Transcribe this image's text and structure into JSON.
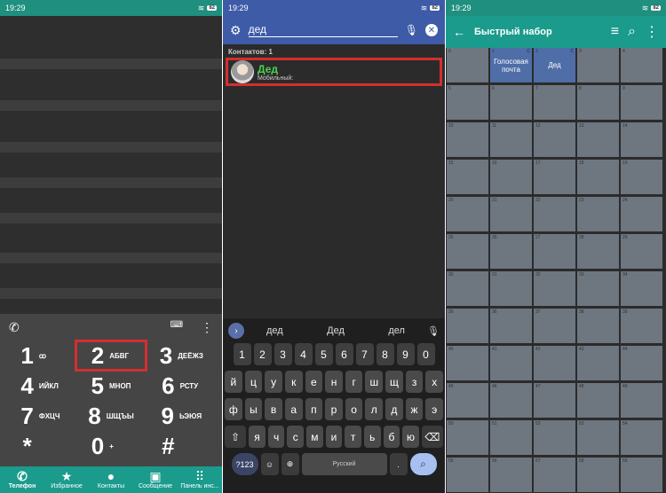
{
  "status": {
    "time": "19:29",
    "battery": "82"
  },
  "dialer": {
    "keys": [
      {
        "digit": "1",
        "letters": "ꝏ"
      },
      {
        "digit": "2",
        "letters": "АБВГ"
      },
      {
        "digit": "3",
        "letters": "ДЕЁЖЗ"
      },
      {
        "digit": "4",
        "letters": "ИЙКЛ"
      },
      {
        "digit": "5",
        "letters": "МНОП"
      },
      {
        "digit": "6",
        "letters": "РСТУ"
      },
      {
        "digit": "7",
        "letters": "ФХЦЧ"
      },
      {
        "digit": "8",
        "letters": "ШЩЪЫ"
      },
      {
        "digit": "9",
        "letters": "ЬЭЮЯ"
      },
      {
        "digit": "*",
        "letters": ""
      },
      {
        "digit": "0",
        "letters": "+"
      },
      {
        "digit": "#",
        "letters": ""
      }
    ],
    "nav": [
      {
        "label": "Телефон",
        "icon": "phone-icon",
        "glyph": "✆"
      },
      {
        "label": "Избранное",
        "icon": "star-icon",
        "glyph": "★"
      },
      {
        "label": "Контакты",
        "icon": "person-icon",
        "glyph": "●"
      },
      {
        "label": "Сообщение",
        "icon": "message-icon",
        "glyph": "▣"
      },
      {
        "label": "Панель инс...",
        "icon": "apps-icon",
        "glyph": "⠿"
      }
    ]
  },
  "search": {
    "query": "дед",
    "count_label": "Контактов: 1",
    "contact": {
      "name": "Дед",
      "type": "Мобильный:"
    },
    "suggestions": [
      "дед",
      "Дед",
      "дел"
    ],
    "rows": [
      [
        "1",
        "2",
        "3",
        "4",
        "5",
        "6",
        "7",
        "8",
        "9",
        "0"
      ],
      [
        "й",
        "ц",
        "у",
        "к",
        "е",
        "н",
        "г",
        "ш",
        "щ",
        "з",
        "х"
      ],
      [
        "ф",
        "ы",
        "в",
        "а",
        "п",
        "р",
        "о",
        "л",
        "д",
        "ж",
        "э"
      ],
      [
        "я",
        "ч",
        "с",
        "м",
        "и",
        "т",
        "ь",
        "б",
        "ю"
      ]
    ],
    "key_symbols": "?123",
    "space_label": "Русский",
    "period": "."
  },
  "speed_dial": {
    "title": "Быстрый набор",
    "cells": [
      {
        "n": "0",
        "label": "",
        "c": ""
      },
      {
        "n": "1",
        "label": "Голосовая почта",
        "c": "С"
      },
      {
        "n": "2",
        "label": "Дед",
        "c": "С"
      },
      {
        "n": "3",
        "label": "",
        "c": ""
      },
      {
        "n": "4",
        "label": "",
        "c": ""
      }
    ],
    "blank_numbers": [
      "5",
      "6",
      "7",
      "8",
      "9",
      "10",
      "11",
      "12",
      "13",
      "14",
      "15",
      "16",
      "17",
      "18",
      "19",
      "20",
      "21",
      "22",
      "23",
      "24",
      "25",
      "26",
      "27",
      "28",
      "29",
      "30",
      "31",
      "32",
      "33",
      "34",
      "35",
      "36",
      "37",
      "38",
      "39",
      "40",
      "41",
      "42",
      "43",
      "44",
      "45",
      "46",
      "47",
      "48",
      "49",
      "50",
      "51",
      "52",
      "53",
      "54",
      "55",
      "56",
      "57",
      "58",
      "59"
    ]
  }
}
